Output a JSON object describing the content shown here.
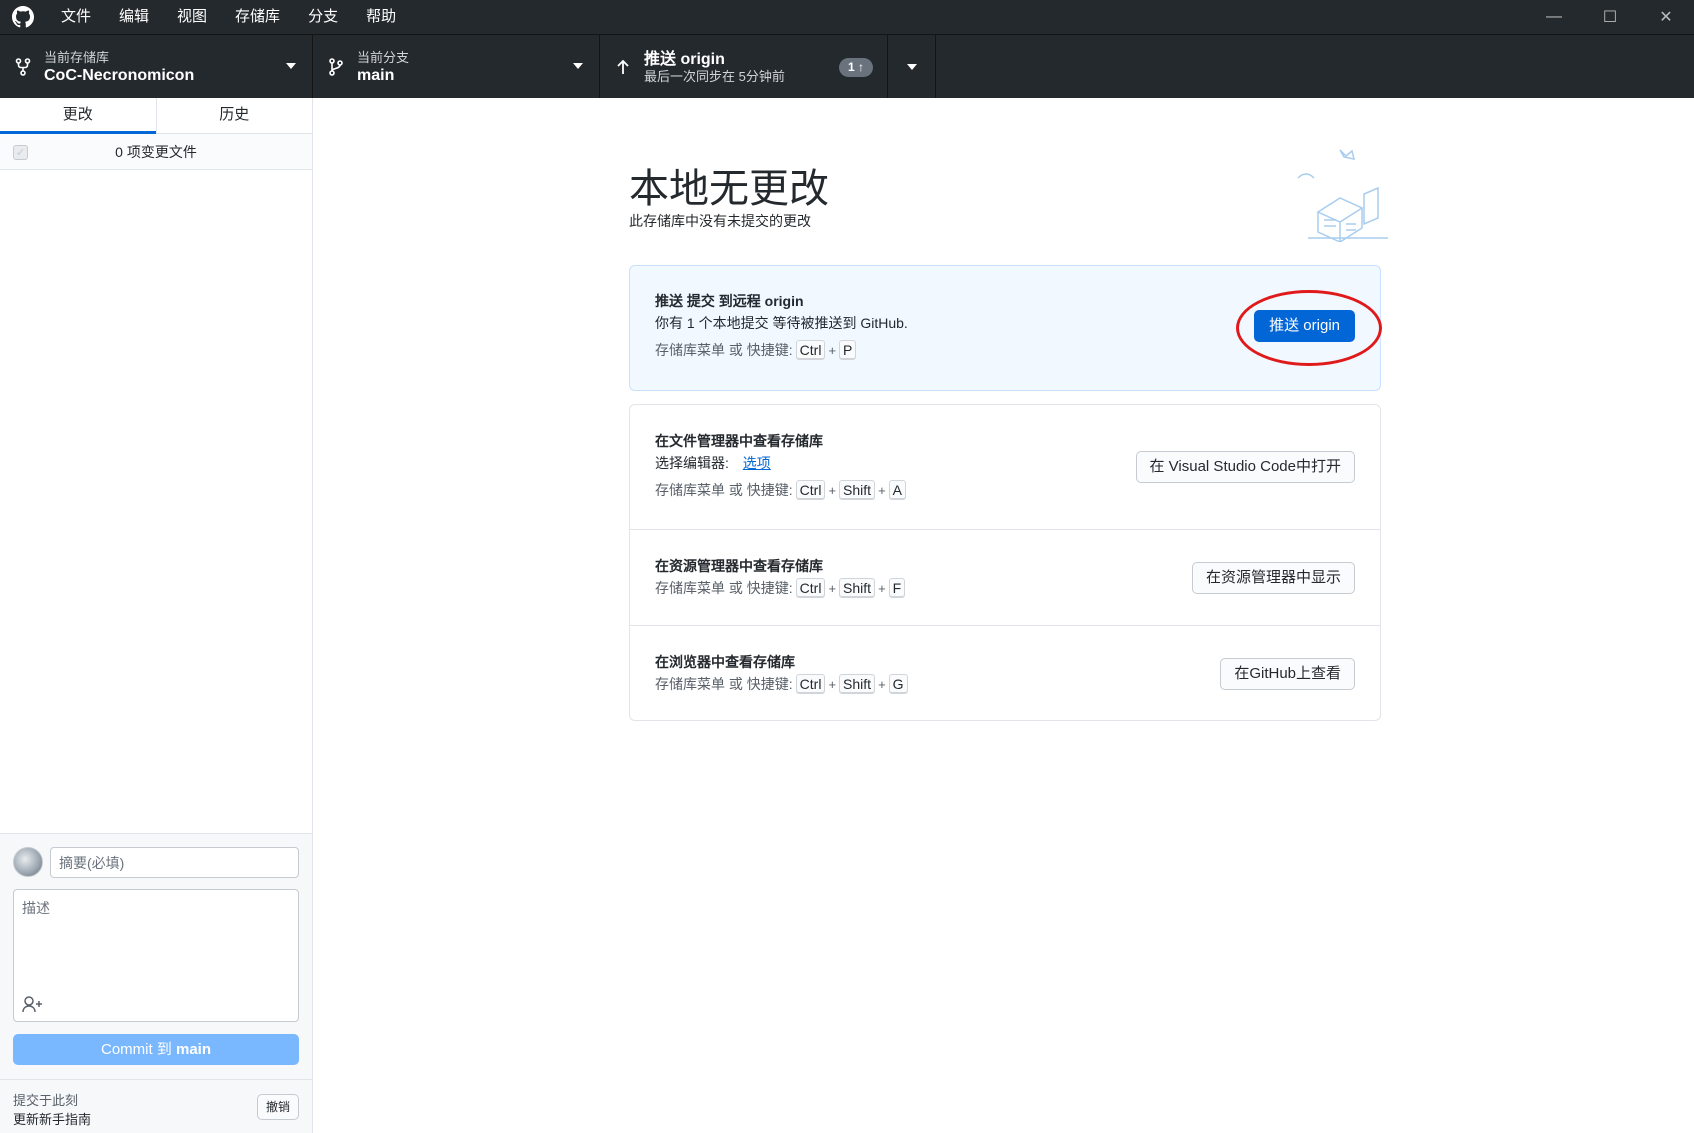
{
  "titlebar": {
    "menu": [
      "文件",
      "编辑",
      "视图",
      "存储库",
      "分支",
      "帮助"
    ],
    "controls": {
      "minimize": "—",
      "maximize": "☐",
      "close": "✕"
    }
  },
  "toolbar": {
    "repo": {
      "label": "当前存储库",
      "value": "CoC-Necronomicon"
    },
    "branch": {
      "label": "当前分支",
      "value": "main"
    },
    "push": {
      "label": "推送 origin",
      "sub": "最后一次同步在 5分钟前",
      "badge": "1 ↑"
    }
  },
  "sidebar": {
    "tabs": [
      "更改",
      "历史"
    ],
    "changes_count": "0 项变更文件",
    "commit": {
      "summary_placeholder": "摘要(必填)",
      "description_placeholder": "描述",
      "button_prefix": "Commit 到 ",
      "button_branch": "main"
    },
    "undo": {
      "line1": "提交于此刻",
      "line2": "更新新手指南",
      "button": "撤销"
    }
  },
  "main": {
    "title": "本地无更改",
    "subtitle": "此存储库中没有未提交的更改",
    "push_card": {
      "title": "推送 提交 到远程 origin",
      "desc": "你有 1 个本地提交 等待被推送到 GitHub.",
      "shortcut_prefix": "存储库菜单 或 快捷键:",
      "keys": [
        "Ctrl",
        "P"
      ],
      "button": "推送 origin"
    },
    "editor_row": {
      "title": "在文件管理器中查看存储库",
      "desc_prefix": "选择编辑器:",
      "desc_link": "选项",
      "shortcut_prefix": "存储库菜单 或 快捷键:",
      "keys": [
        "Ctrl",
        "Shift",
        "A"
      ],
      "button": "在 Visual Studio Code中打开"
    },
    "explorer_row": {
      "title": "在资源管理器中查看存储库",
      "shortcut_prefix": "存储库菜单 或 快捷键:",
      "keys": [
        "Ctrl",
        "Shift",
        "F"
      ],
      "button": "在资源管理器中显示"
    },
    "browser_row": {
      "title": "在浏览器中查看存储库",
      "shortcut_prefix": "存储库菜单 或 快捷键:",
      "keys": [
        "Ctrl",
        "Shift",
        "G"
      ],
      "button": "在GitHub上查看"
    }
  },
  "colors": {
    "accent": "#0366d6",
    "annotation": "#e01a1a",
    "titlebar": "#24292e"
  }
}
